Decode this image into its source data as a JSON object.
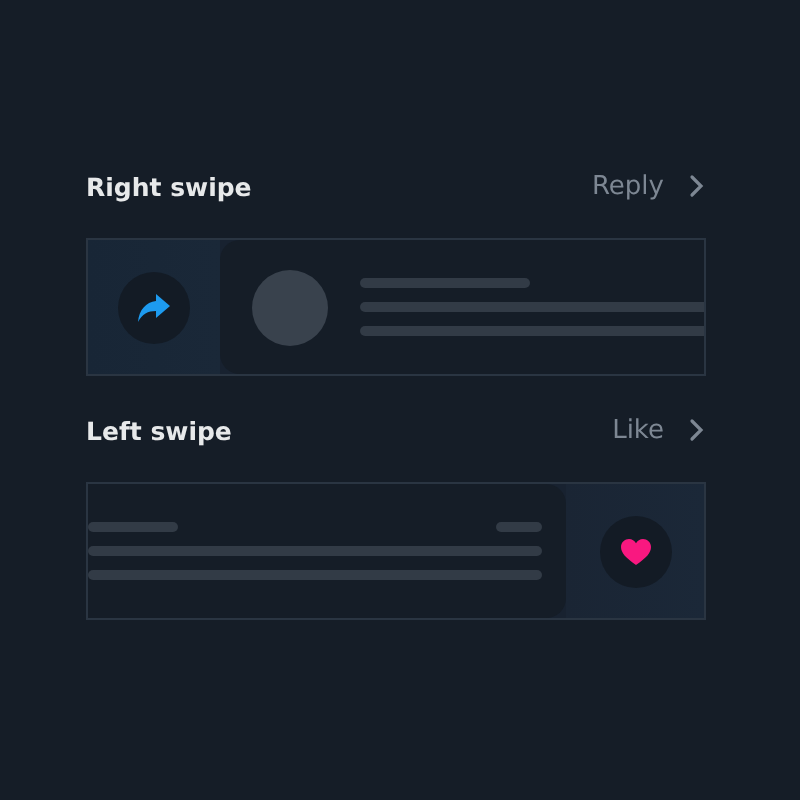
{
  "sections": [
    {
      "title": "Right swipe",
      "action": "Reply",
      "kind": "right"
    },
    {
      "title": "Left swipe",
      "action": "Like",
      "kind": "left"
    }
  ]
}
